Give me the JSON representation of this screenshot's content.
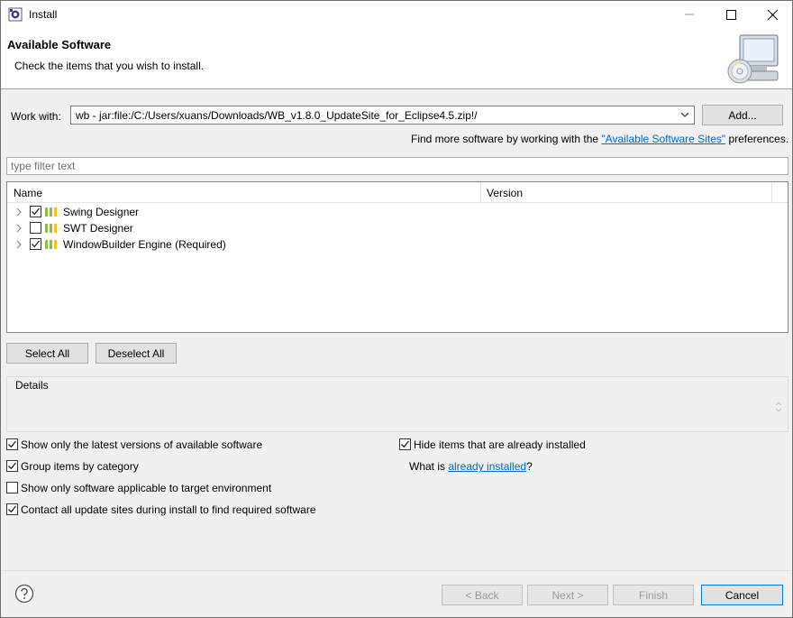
{
  "window": {
    "title": "Install"
  },
  "header": {
    "title": "Available Software",
    "description": "Check the items that you wish to install."
  },
  "work_with": {
    "label": "Work with:",
    "value": "wb - jar:file:/C:/Users/xuans/Downloads/WB_v1.8.0_UpdateSite_for_Eclipse4.5.zip!/",
    "add_label": "Add..."
  },
  "find_more": {
    "prefix": "Find more software by working with the ",
    "link": "\"Available Software Sites\"",
    "suffix": " preferences."
  },
  "filter": {
    "placeholder": "type filter text",
    "value": ""
  },
  "tree": {
    "columns": [
      "Name",
      "Version"
    ],
    "items": [
      {
        "label": "Swing Designer",
        "checked": true,
        "version": ""
      },
      {
        "label": "SWT Designer",
        "checked": false,
        "version": ""
      },
      {
        "label": "WindowBuilder Engine (Required)",
        "checked": true,
        "version": ""
      }
    ]
  },
  "buttons": {
    "select_all": "Select All",
    "deselect_all": "Deselect All",
    "back": "< Back",
    "next": "Next >",
    "finish": "Finish",
    "cancel": "Cancel"
  },
  "details": {
    "label": "Details"
  },
  "options": {
    "latest_versions": {
      "label": "Show only the latest versions of available software",
      "checked": true
    },
    "group_by_category": {
      "label": "Group items by category",
      "checked": true
    },
    "applicable_only": {
      "label": "Show only software applicable to target environment",
      "checked": false
    },
    "contact_sites": {
      "label": "Contact all update sites during install to find required software",
      "checked": true
    },
    "hide_installed": {
      "label": "Hide items that are already installed",
      "checked": true
    }
  },
  "what_is": {
    "prefix": "What is ",
    "link": "already installed",
    "suffix": "?"
  },
  "icons": {
    "app": "eclipse-install-icon",
    "minimize": "minimize-icon",
    "maximize": "maximize-icon",
    "close": "close-icon",
    "wizard_banner": "computer-cd-icon",
    "help": "help-icon",
    "package": "feature-group-icon",
    "expander": "chevron-right-icon",
    "dropdown": "chevron-down-icon"
  },
  "colors": {
    "link": "#0066cc",
    "accent": "#0078d7"
  }
}
